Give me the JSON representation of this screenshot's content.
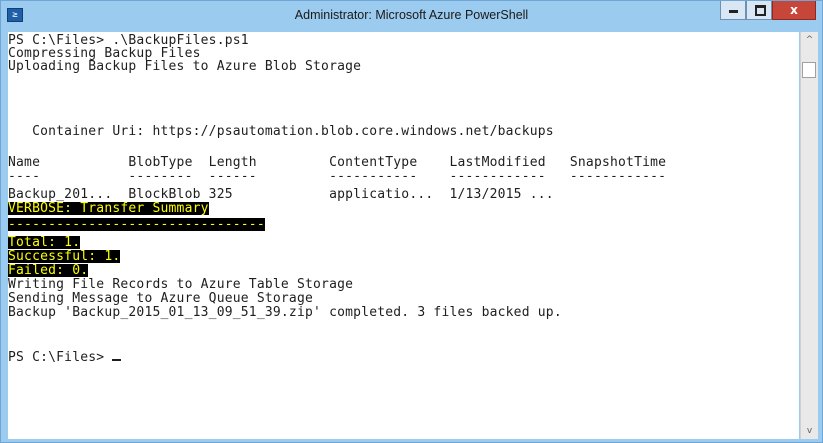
{
  "window": {
    "title": "Administrator: Microsoft Azure PowerShell",
    "icon_glyph": "≥",
    "icon_name": "powershell-icon",
    "close_glyph": "x"
  },
  "colors": {
    "titlebar": "#9ccbf0",
    "console_background": "#ffffff",
    "console_text": "#1e1e1e",
    "highlight_background": "#000000",
    "highlight_text": "#ffff00",
    "close_button": "#c7463a"
  },
  "console": {
    "lines": [
      "PS C:\\Files> .\\BackupFiles.ps1",
      "Compressing Backup Files",
      "Uploading Backup Files to Azure Blob Storage",
      "",
      "",
      "   Container Uri: https://psautomation.blob.core.windows.net/backups",
      "",
      "Name           BlobType  Length         ContentType    LastModified   SnapshotTime",
      "----           --------  ------         -----------    ------------   ------------",
      "Backup_201...  BlockBlob 325            applicatio...  1/13/2015 ...",
      "VERBOSE: Transfer Summary",
      "--------------------------------",
      "Total: 1.",
      "Successful: 1.",
      "Failed: 0.",
      "Writing File Records to Azure Table Storage",
      "Sending Message to Azure Queue Storage",
      "Backup 'Backup_2015_01_13_09_51_39.zip' completed. 3 files backed up.",
      "",
      "",
      "PS C:\\Files> "
    ]
  },
  "scrollbar": {
    "up_arrow": "^",
    "down_arrow": "v"
  }
}
